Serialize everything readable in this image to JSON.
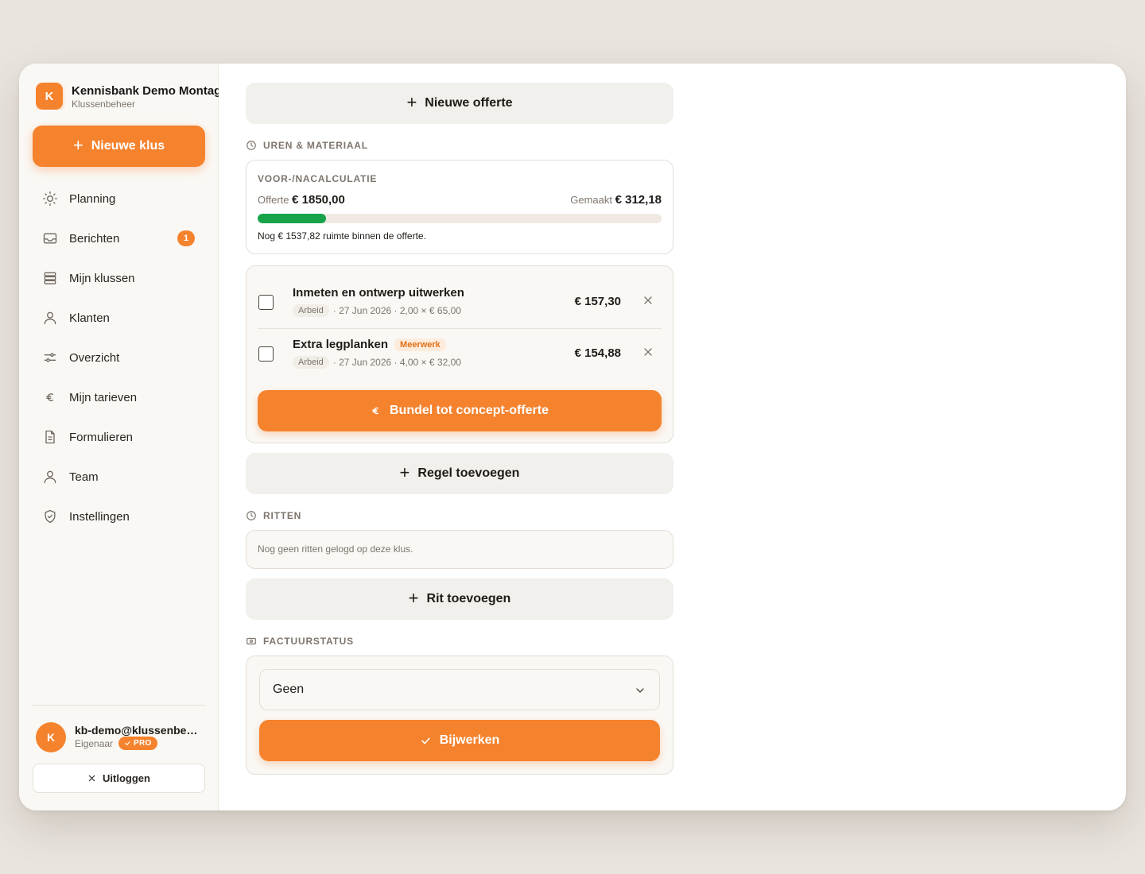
{
  "app": {
    "brand_initial": "K",
    "brand_name": "Kennisbank Demo Montage",
    "brand_subtitle": "Klussenbeheer",
    "accent_color": "#f5822d"
  },
  "sidebar": {
    "new_job_label": "Nieuwe klus",
    "items": [
      {
        "label": "Planning",
        "icon": "sun-icon"
      },
      {
        "label": "Berichten",
        "icon": "inbox-icon",
        "badge": "1"
      },
      {
        "label": "Mijn klussen",
        "icon": "stack-icon"
      },
      {
        "label": "Klanten",
        "icon": "user-icon"
      },
      {
        "label": "Overzicht",
        "icon": "sliders-icon"
      },
      {
        "label": "Mijn tarieven",
        "icon": "euro-icon"
      },
      {
        "label": "Formulieren",
        "icon": "document-icon"
      },
      {
        "label": "Team",
        "icon": "user-icon"
      },
      {
        "label": "Instellingen",
        "icon": "shield-icon"
      }
    ],
    "user": {
      "initial": "K",
      "email": "kb-demo@klussenbeheer.nl",
      "role": "Eigenaar",
      "plan_badge": "PRO"
    },
    "logout_label": "Uitloggen"
  },
  "main": {
    "new_quote_label": "Nieuwe offerte",
    "hours_section": "UREN & MATERIAAL",
    "calc": {
      "title": "VOOR-/NACALCULATIE",
      "offerte_label": "Offerte",
      "offerte_value": "€ 1850,00",
      "made_label": "Gemaakt",
      "made_value": "€ 312,18",
      "progress_percent": 16.9,
      "progress_color": "#17a34a",
      "note": "Nog € 1537,82 ruimte binnen de offerte."
    },
    "lines": [
      {
        "title": "Inmeten en ontwerp uitwerken",
        "tag": "",
        "type": "Arbeid",
        "meta": "· 27 Jun 2026 · 2,00 × € 65,00",
        "price": "€ 157,30"
      },
      {
        "title": "Extra legplanken",
        "tag": "Meerwerk",
        "type": "Arbeid",
        "meta": "· 27 Jun 2026 · 4,00 × € 32,00",
        "price": "€ 154,88"
      }
    ],
    "bundle_label": "Bundel tot concept-offerte",
    "add_line_label": "Regel toevoegen",
    "trips_section": "RITTEN",
    "trips_empty": "Nog geen ritten gelogd op deze klus.",
    "add_trip_label": "Rit toevoegen",
    "invoice_section": "FACTUURSTATUS",
    "invoice_status_value": "Geen",
    "update_label": "Bijwerken"
  }
}
